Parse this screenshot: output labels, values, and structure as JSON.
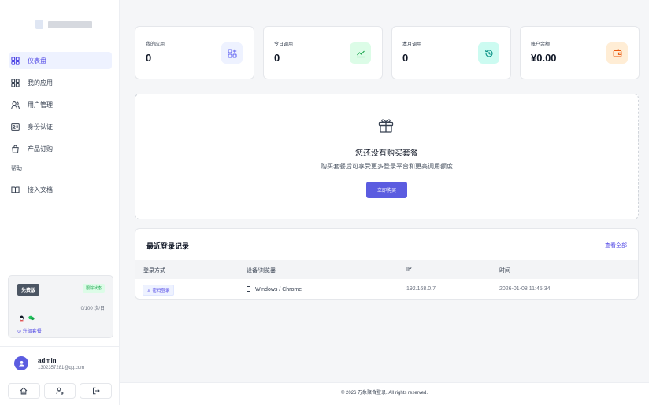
{
  "sidebar": {
    "nav": [
      {
        "label": "仪表盘",
        "icon": "dashboard-icon",
        "active": true
      },
      {
        "label": "我的应用",
        "icon": "apps-icon",
        "active": false
      },
      {
        "label": "用户管理",
        "icon": "users-icon",
        "active": false
      },
      {
        "label": "身份认证",
        "icon": "id-card-icon",
        "active": false
      },
      {
        "label": "产品订购",
        "icon": "shopping-bag-icon",
        "active": false
      }
    ],
    "section_help": "帮助",
    "help_items": [
      {
        "label": "接入文档",
        "icon": "book-icon"
      }
    ],
    "plan": {
      "name": "免费版",
      "status": "跟踪状态",
      "quota": "0/100 次/日",
      "upgrade": "⊙ 升级套餐"
    },
    "user": {
      "name": "admin",
      "email": "1302357281@qq.com"
    },
    "actions": [
      "home-icon",
      "user-settings-icon",
      "logout-icon"
    ]
  },
  "stats": [
    {
      "label": "我的应用",
      "value": "0",
      "icon": "apps-icon",
      "color": "#6366f1",
      "bg": "#eef2ff"
    },
    {
      "label": "今日调用",
      "value": "0",
      "icon": "trend-icon",
      "color": "#16a34a",
      "bg": "#dcfce7"
    },
    {
      "label": "本月调用",
      "value": "0",
      "icon": "history-icon",
      "color": "#0d9488",
      "bg": "#ccfbf1"
    },
    {
      "label": "账户余额",
      "value": "¥0.00",
      "icon": "wallet-icon",
      "color": "#ea580c",
      "bg": "#ffedd5"
    }
  ],
  "promo": {
    "title": "您还没有购买套餐",
    "subtitle": "购买套餐后可享受更多登录平台和更高调用额度",
    "button": "立即购买"
  },
  "recent_logins": {
    "title": "最近登录记录",
    "view_all": "查看全部",
    "columns": [
      "登录方式",
      "设备/浏览器",
      "IP",
      "时间"
    ],
    "rows": [
      {
        "method": "♙ 密码登录",
        "device": "Windows / Chrome",
        "ip": "192.168.0.7",
        "time": "2026-01-08 11:45:34"
      }
    ]
  },
  "footer": "© 2026 万象聚合登录. All rights reserved.",
  "colors": {
    "accent": "#5b5ce0",
    "page_bg": "#f5f6f8"
  }
}
